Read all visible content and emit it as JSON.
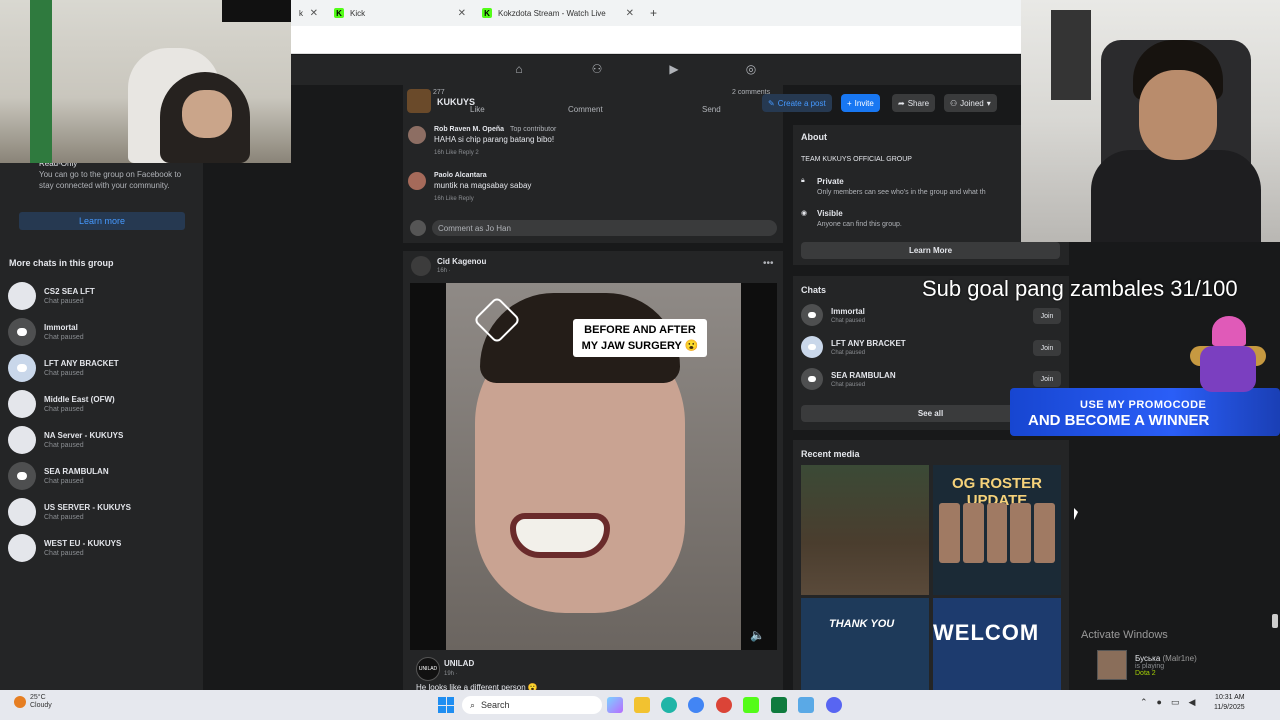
{
  "browser": {
    "tabs": [
      {
        "label": "k"
      },
      {
        "label": "Kick"
      },
      {
        "label": "Kokzdota Stream - Watch Live"
      }
    ],
    "newtab_icon": "+"
  },
  "group": {
    "name": "KUKUYS",
    "reactions": "277",
    "comments_count": "2 comments",
    "actions": {
      "like": "Like",
      "comment": "Comment",
      "send": "Send"
    },
    "buttons": {
      "create": "Create a post",
      "invite": "Invite",
      "share": "Share",
      "joined": "Joined"
    }
  },
  "sidebar": {
    "readonly_title": "Read-Only",
    "readonly_text": "You can go to the group on Facebook to stay connected with your community.",
    "learn_more": "Learn more",
    "more_chats_title": "More chats in this group",
    "chats": [
      {
        "name": "CS2 SEA LFT",
        "status": "Chat paused"
      },
      {
        "name": "Immortal",
        "status": "Chat paused"
      },
      {
        "name": "LFT ANY BRACKET",
        "status": "Chat paused"
      },
      {
        "name": "Middle East (OFW)",
        "status": "Chat paused"
      },
      {
        "name": "NA Server - KUKUYS",
        "status": "Chat paused"
      },
      {
        "name": "SEA RAMBULAN",
        "status": "Chat paused"
      },
      {
        "name": "US SERVER - KUKUYS",
        "status": "Chat paused"
      },
      {
        "name": "WEST EU - KUKUYS",
        "status": "Chat paused"
      }
    ]
  },
  "comments": [
    {
      "name": "Rob Raven M. Opeña",
      "badge": "Top contributor",
      "text": "HAHA si chip parang batang bibo!",
      "meta": "16h   Like   Reply",
      "count": "2"
    },
    {
      "name": "Paolo Alcantara",
      "text": "muntik na magsabay sabay",
      "meta": "16h   Like   Reply"
    }
  ],
  "comment_placeholder": "Comment as Jo Han",
  "post2": {
    "author": "Cid Kagenou",
    "time": "16h · ",
    "video_caption_line1": "BEFORE AND AFTER",
    "video_caption_line2": "MY JAW SURGERY 😮",
    "shared_author": "UNILAD",
    "shared_time": "19h · ",
    "shared_text": "He looks like a different person 😮"
  },
  "about": {
    "title": "About",
    "description": "TEAM KUKUYS OFFICIAL GROUP",
    "private_title": "Private",
    "private_text": "Only members can see who's in the group and what th",
    "visible_title": "Visible",
    "visible_text": "Anyone can find this group.",
    "learn_more": "Learn More"
  },
  "right_chats": {
    "title": "Chats",
    "items": [
      {
        "name": "Immortal",
        "status": "Chat paused",
        "join": "Join"
      },
      {
        "name": "LFT ANY BRACKET",
        "status": "Chat paused",
        "join": "Join"
      },
      {
        "name": "SEA RAMBULAN",
        "status": "Chat paused",
        "join": "Join"
      }
    ],
    "see_all": "See all"
  },
  "recent_media": {
    "title": "Recent media",
    "thumb2_header": "OG ROSTER UPDATE",
    "thumb3_header": "THANK YOU",
    "thumb4_header": "WELCOM"
  },
  "overlay": {
    "sub_goal": "Sub goal pang zambales 31/100",
    "promo_line1": "USE MY PROMOCODE",
    "promo_line2": "AND BECOME A WINNER",
    "activate": "Activate Windows",
    "steam_name": "Буська",
    "steam_alias": "(Malr1ne)",
    "steam_status": "is playing",
    "steam_game": "Dota 2"
  },
  "taskbar": {
    "temp": "25°C",
    "condition": "Cloudy",
    "search": "Search",
    "time": "10:31 AM",
    "date": "11/9/2025"
  },
  "colors": {
    "fb_blue": "#1877f2",
    "kick_green": "#53fc18",
    "promo_blue": "#2a5ef7"
  }
}
